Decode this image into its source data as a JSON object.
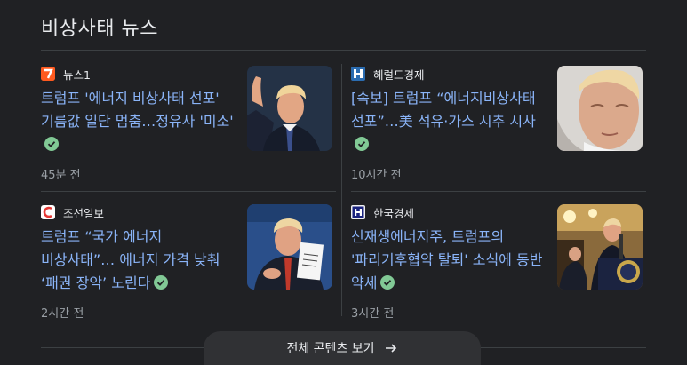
{
  "section": {
    "title": "비상사태 뉴스"
  },
  "articles": [
    {
      "source": "뉴스1",
      "favicon_color": "#ff5a1f",
      "favicon_glyph": "1",
      "headline": "트럼프 '에너지 비상사태 선포' 기름값 일단 멈춤…정유사 '미소'",
      "time": "45분 전",
      "thumb_icon": "photo-trump-waving"
    },
    {
      "source": "헤럴드경제",
      "favicon_color": "#2b6cb0",
      "favicon_glyph": "H",
      "headline": "[속보] 트럼프 “에너지비상사태 선포”…美 석유·가스 시추 시사",
      "time": "10시간 전",
      "thumb_icon": "photo-trump-closeup"
    },
    {
      "source": "조선일보",
      "favicon_color": "#e53935",
      "favicon_glyph": "C",
      "headline": "트럼프 “국가 에너지 비상사태”… 에너지 가격 낮춰 ‘패권 장악’ 노린다",
      "time": "2시간 전",
      "thumb_icon": "photo-trump-signing"
    },
    {
      "source": "한국경제",
      "favicon_color": "#1a237e",
      "favicon_glyph": "H",
      "headline": "신재생에너지주, 트럼프의 '파리기후협약 탈퇴' 소식에 동반 약세",
      "time": "3시간 전",
      "thumb_icon": "photo-trump-podium"
    }
  ],
  "more_button": {
    "label": "전체 콘텐츠 보기"
  },
  "colors": {
    "background": "#202124",
    "headline": "#8ab4f8",
    "meta": "#9aa0a6",
    "verified": "#81c995"
  }
}
